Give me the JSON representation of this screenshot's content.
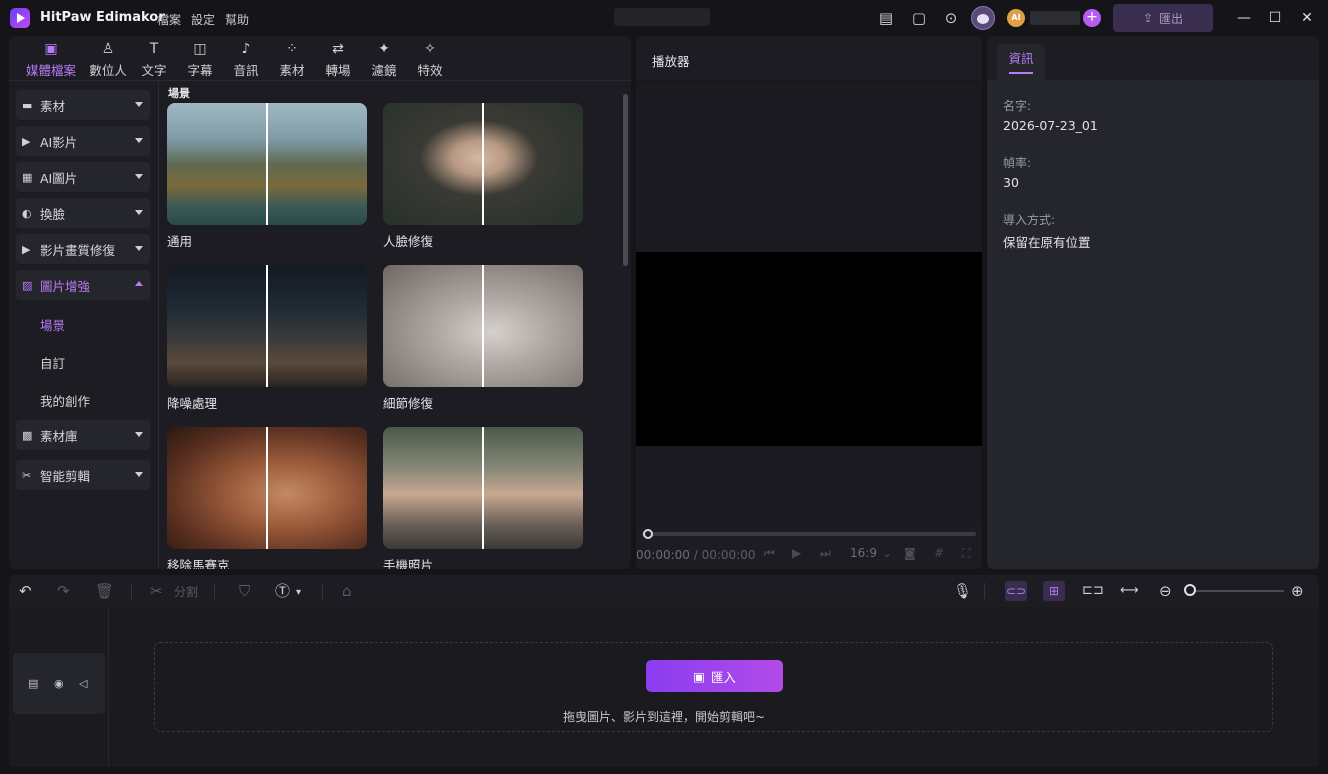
{
  "app": {
    "title": "HitPaw Edimakor",
    "menus": [
      "檔案",
      "設定",
      "幫助"
    ],
    "export_label": "匯出",
    "coin_label": "AI"
  },
  "top_tabs": [
    {
      "label": "媒體檔案",
      "icon": "media-icon"
    },
    {
      "label": "數位人",
      "icon": "avatar-person-icon"
    },
    {
      "label": "文字",
      "icon": "text-icon"
    },
    {
      "label": "字幕",
      "icon": "subtitle-icon"
    },
    {
      "label": "音訊",
      "icon": "music-icon"
    },
    {
      "label": "素材",
      "icon": "asset-icon"
    },
    {
      "label": "轉場",
      "icon": "transition-icon"
    },
    {
      "label": "濾鏡",
      "icon": "filter-icon"
    },
    {
      "label": "特效",
      "icon": "effect-icon"
    }
  ],
  "sidebar": {
    "items": [
      {
        "label": "素材"
      },
      {
        "label": "AI影片"
      },
      {
        "label": "AI圖片"
      },
      {
        "label": "換臉"
      },
      {
        "label": "影片畫質修復"
      },
      {
        "label": "圖片增強"
      },
      {
        "label": "素材庫"
      },
      {
        "label": "智能剪輯"
      }
    ],
    "sub_items": [
      "場景",
      "自訂",
      "我的創作"
    ]
  },
  "content": {
    "section_title": "場景",
    "cards": [
      {
        "label": "通用"
      },
      {
        "label": "人臉修復"
      },
      {
        "label": "降噪處理"
      },
      {
        "label": "細節修復"
      },
      {
        "label": "移除馬賽克"
      },
      {
        "label": "手機照片"
      }
    ]
  },
  "player": {
    "title": "播放器",
    "time_current": "00:00:00",
    "time_sep": "/",
    "time_total": "00:00:00",
    "ratio": "16:9"
  },
  "info": {
    "tab": "資訊",
    "fields": [
      {
        "label": "名字:",
        "value": "2026-07-23_01"
      },
      {
        "label": "幀率:",
        "value": "30"
      },
      {
        "label": "導入方式:",
        "value": "保留在原有位置"
      }
    ]
  },
  "timeline": {
    "split_label": "分割",
    "import_label": "匯入",
    "drop_hint": "拖曳圖片、影片到這裡，開始剪輯吧~"
  }
}
